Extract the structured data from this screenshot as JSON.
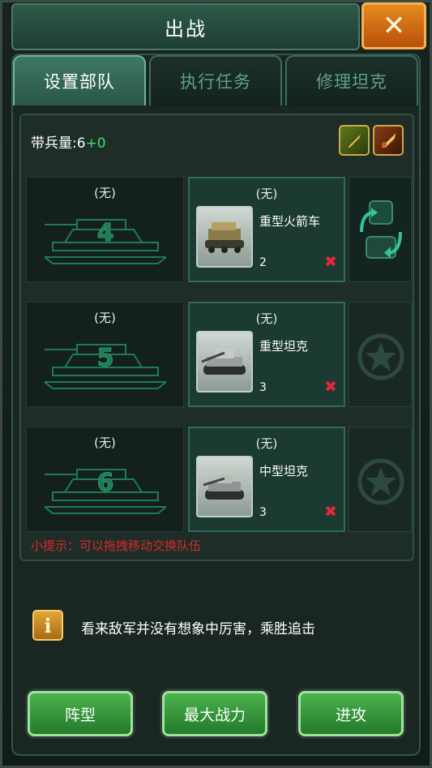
{
  "header": {
    "title": "出战",
    "close_label": "✕"
  },
  "tabs": [
    {
      "label": "设置部队",
      "active": true
    },
    {
      "label": "执行任务",
      "active": false
    },
    {
      "label": "修理坦克",
      "active": false
    }
  ],
  "troops": {
    "label": "带兵量:",
    "base": "6",
    "bonus": "+0"
  },
  "buffs": [
    "shell-buff-icon",
    "rocket-buff-icon"
  ],
  "rows": [
    {
      "slot_number": "4",
      "left_label": "(无)",
      "right_label": "(无)",
      "unit_name": "重型火箭车",
      "unit_count": "2",
      "remove_label": "✖",
      "side": "swap-arrows-icon"
    },
    {
      "slot_number": "5",
      "left_label": "(无)",
      "right_label": "(无)",
      "unit_name": "重型坦克",
      "unit_count": "3",
      "remove_label": "✖",
      "side": "star-emblem-icon"
    },
    {
      "slot_number": "6",
      "left_label": "(无)",
      "right_label": "(无)",
      "unit_name": "中型坦克",
      "unit_count": "3",
      "remove_label": "✖",
      "side": "star-emblem-icon"
    }
  ],
  "hint": "小提示：可以拖拽移动交换队伍",
  "info": {
    "icon_label": "i",
    "text": "看来敌军并没有想象中厉害，乘胜追击"
  },
  "buttons": {
    "formation": "阵型",
    "max_power": "最大战力",
    "attack": "进攻"
  },
  "colors": {
    "accent_green": "#38e06d",
    "hint_red": "#d72a2a",
    "close_orange": "#e48a1e",
    "button_green": "#4bb24d"
  }
}
